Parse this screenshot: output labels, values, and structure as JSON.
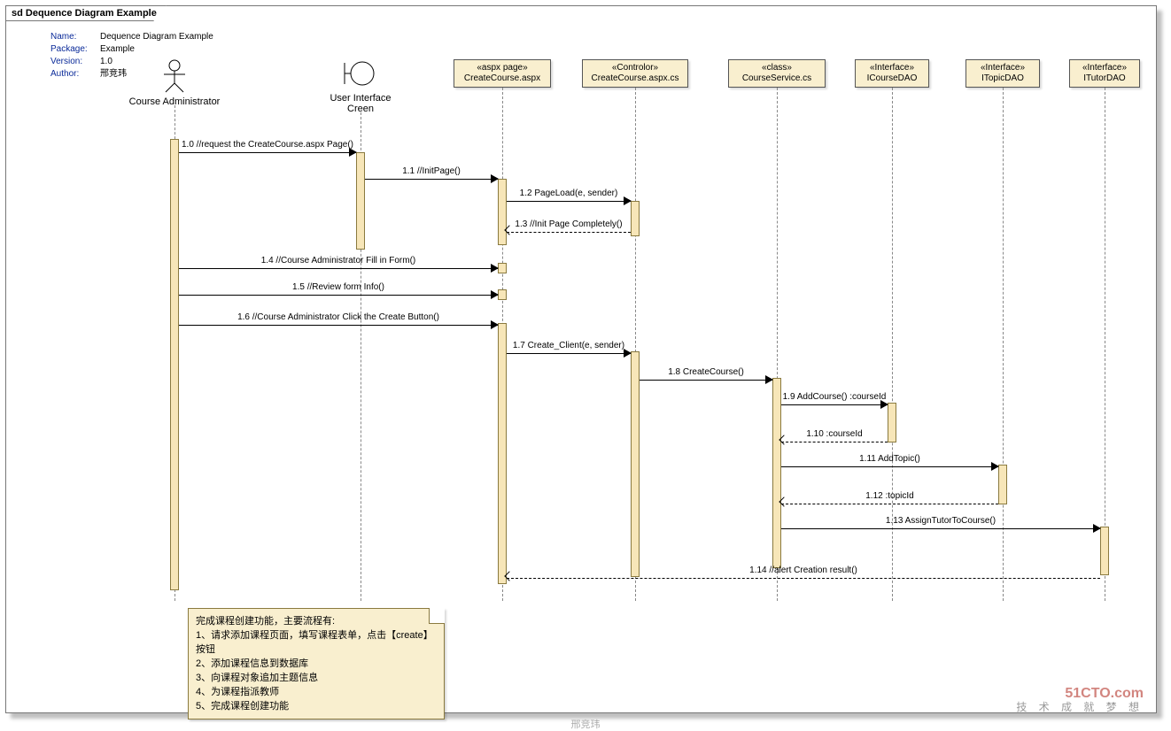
{
  "frame": {
    "title": "sd Dequence Diagram Example"
  },
  "meta": {
    "name_label": "Name:",
    "name": "Dequence Diagram Example",
    "package_label": "Package:",
    "package": "Example",
    "version_label": "Version:",
    "version": "1.0",
    "author_label": "Author:",
    "author": "邢竞玮"
  },
  "participants": {
    "actor": {
      "name": "Course Administrator"
    },
    "boundary": {
      "name": "User Interface Creen"
    },
    "p1": {
      "stereo": "«aspx page»",
      "name": "CreateCourse.aspx"
    },
    "p2": {
      "stereo": "«Controlor»",
      "name": "CreateCourse.aspx.cs"
    },
    "p3": {
      "stereo": "«class»",
      "name": "CourseService.cs"
    },
    "p4": {
      "stereo": "«Interface»",
      "name": "ICourseDAO"
    },
    "p5": {
      "stereo": "«Interface»",
      "name": "ITopicDAO"
    },
    "p6": {
      "stereo": "«Interface»",
      "name": "ITutorDAO"
    }
  },
  "messages": {
    "m1_0": "1.0 //request the CreateCourse.aspx Page()",
    "m1_1": "1.1 //InitPage()",
    "m1_2": "1.2 PageLoad(e, sender)",
    "m1_3": "1.3 //Init Page Completely()",
    "m1_4": "1.4 //Course Administrator Fill in  Form()",
    "m1_5": "1.5 //Review  form Info()",
    "m1_6": "1.6 //Course Administrator Click the Create Button()",
    "m1_7": "1.7 Create_Client(e, sender)",
    "m1_8": "1.8 CreateCourse()",
    "m1_9": "1.9 AddCourse() :courseId",
    "m1_10": "1.10  :courseId",
    "m1_11": "1.11 AddTopic()",
    "m1_12": "1.12  :topicId",
    "m1_13": "1.13 AssignTutorToCourse()",
    "m1_14": "1.14 //alert Creation result()"
  },
  "note": {
    "title": "完成课程创建功能，主要流程有:",
    "l1": "1、请求添加课程页面，填写课程表单，点击【create】按钮",
    "l2": "2、添加课程信息到数据库",
    "l3": "3、向课程对象追加主题信息",
    "l4": "4、为课程指派教师",
    "l5": "5、完成课程创建功能"
  },
  "watermark": {
    "logo": "51CTO.com",
    "sub": "技 术 成 就 梦 想",
    "sig": "邢竞玮"
  }
}
